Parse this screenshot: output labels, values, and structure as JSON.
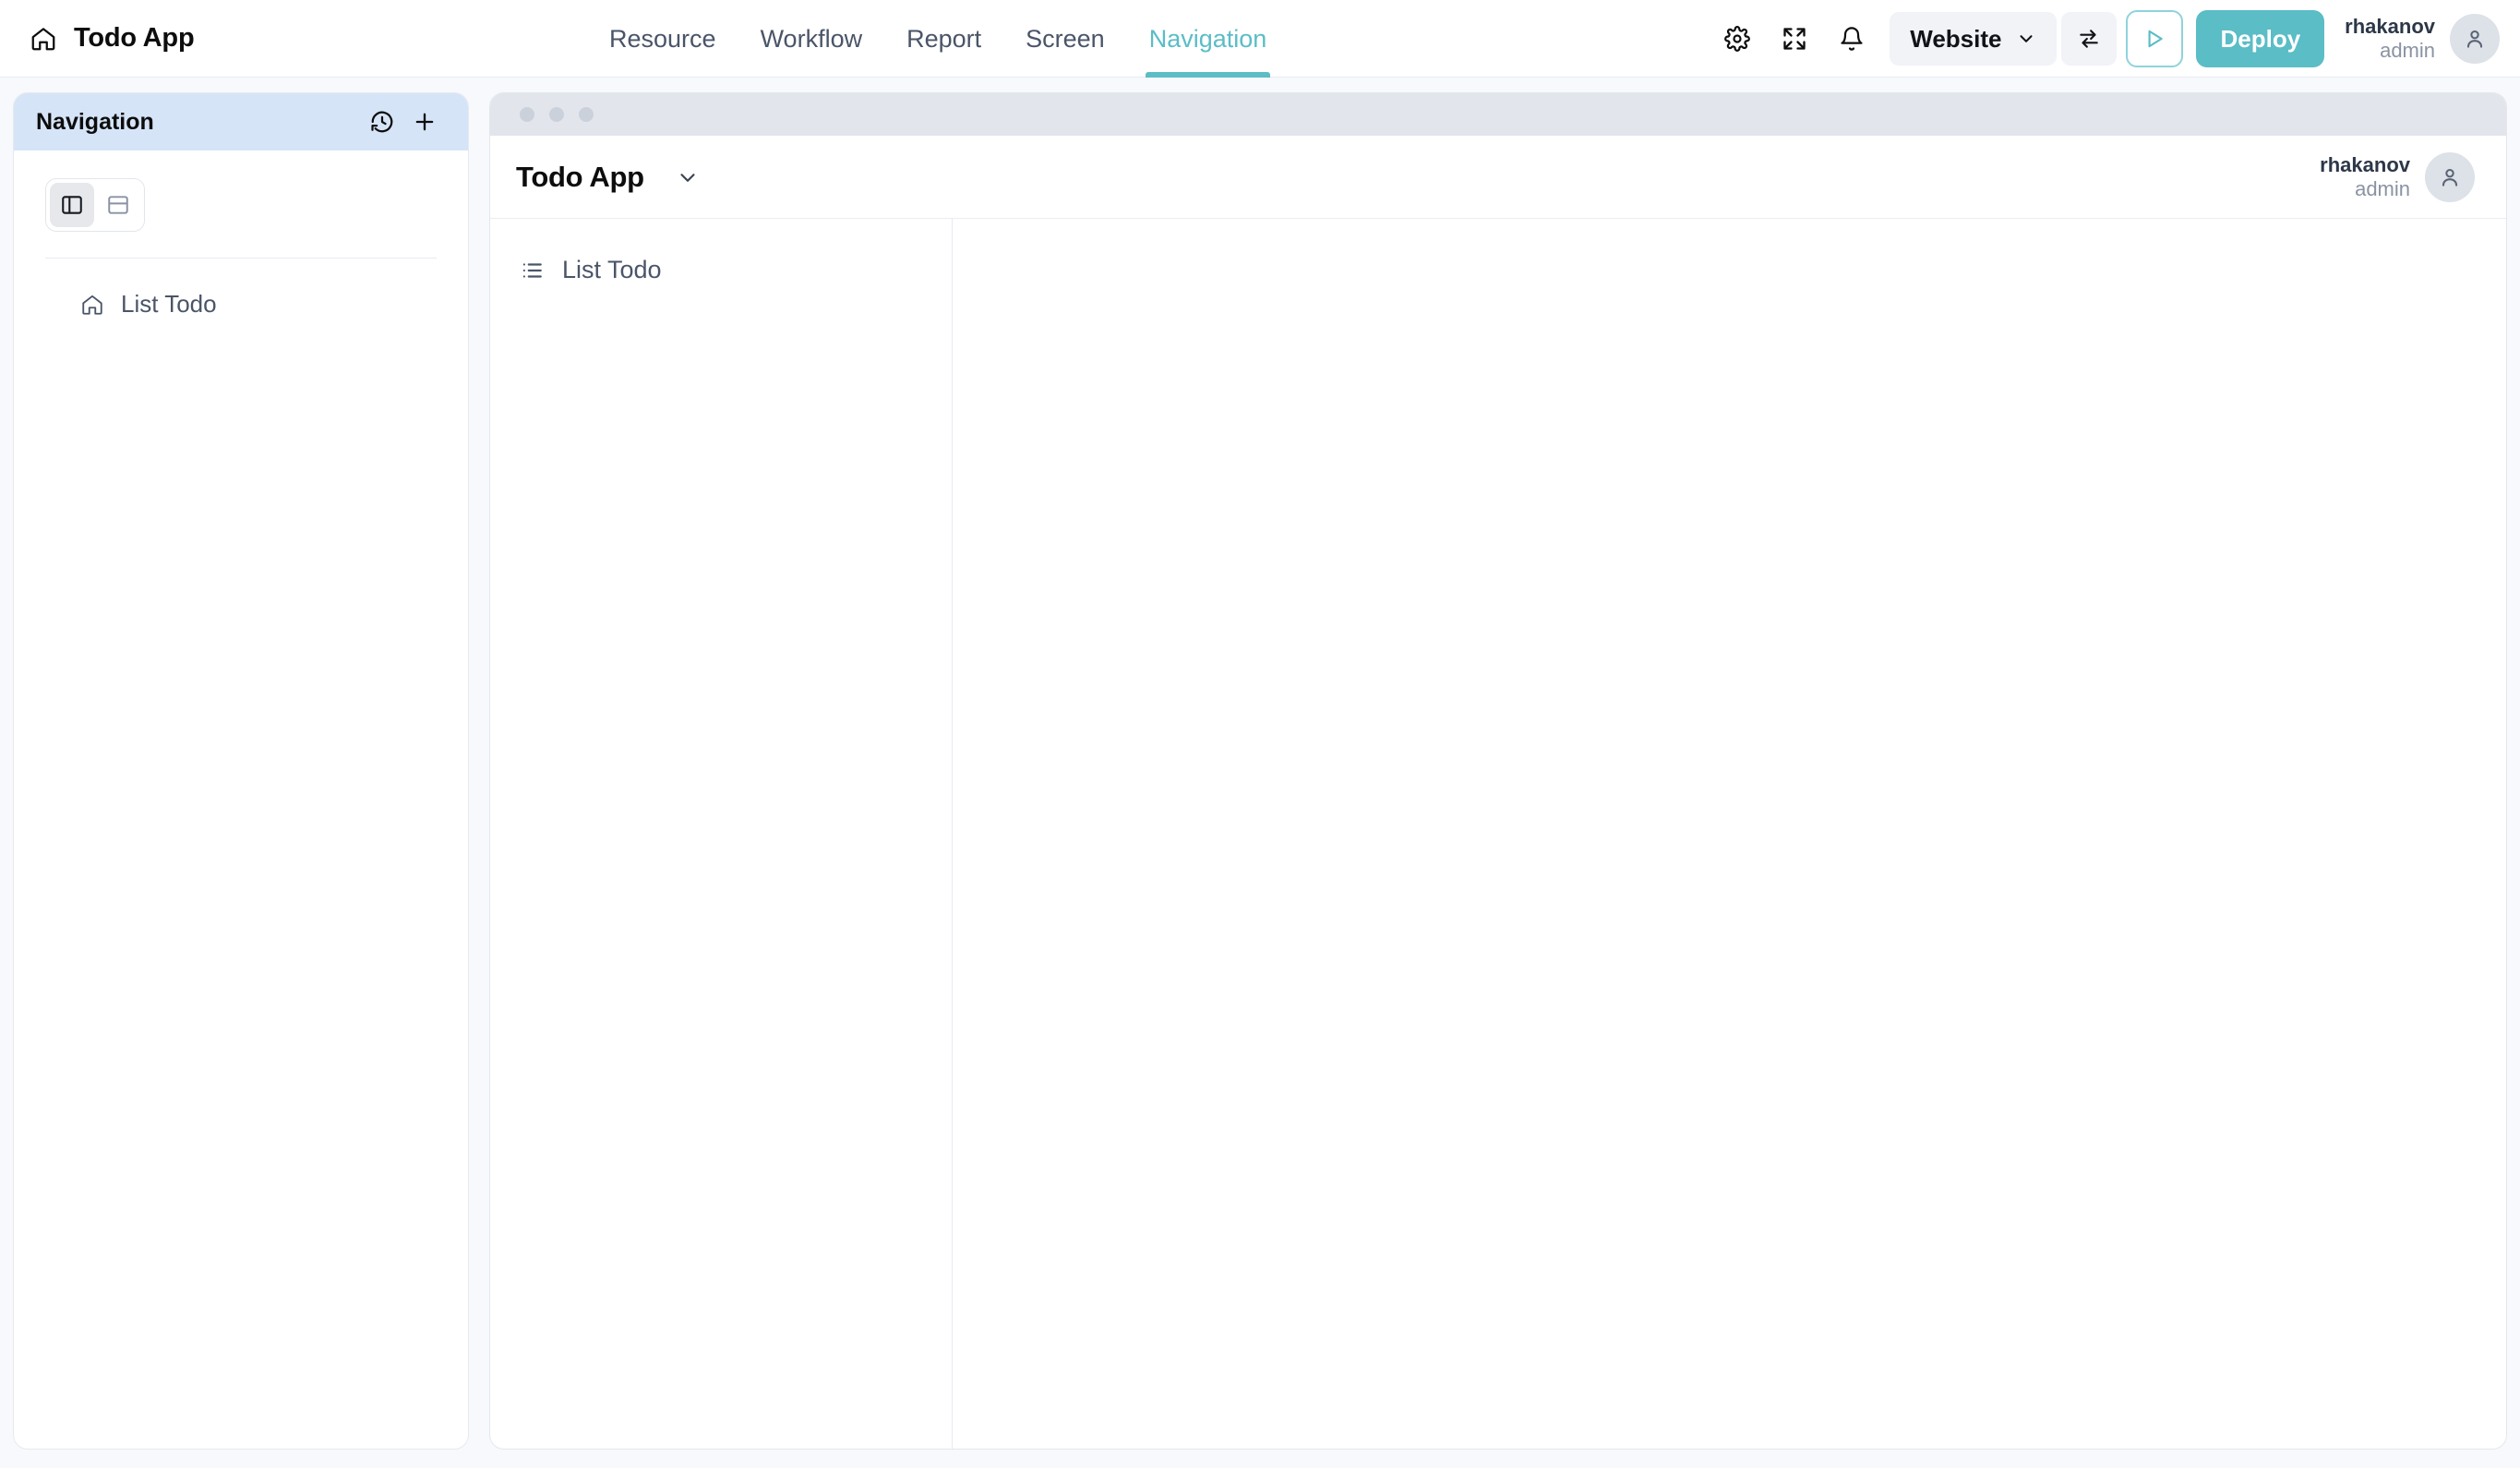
{
  "header": {
    "home_icon": "home-icon",
    "title": "Todo App",
    "tabs": [
      {
        "label": "Resource",
        "active": false
      },
      {
        "label": "Workflow",
        "active": false
      },
      {
        "label": "Report",
        "active": false
      },
      {
        "label": "Screen",
        "active": false
      },
      {
        "label": "Navigation",
        "active": true
      }
    ],
    "actions": {
      "settings_icon": "gear-icon",
      "fullscreen_icon": "expand-icon",
      "notifications_icon": "bell-icon",
      "target_selector": {
        "label": "Website",
        "chevron_icon": "chevron-down-icon"
      },
      "swap_icon": "swap-arrows-icon",
      "preview_icon": "play-icon",
      "deploy_label": "Deploy"
    },
    "user": {
      "name": "rhakanov",
      "role": "admin",
      "avatar_icon": "user-icon"
    }
  },
  "sidebar": {
    "panel_title": "Navigation",
    "history_icon": "history-clock-icon",
    "add_icon": "plus-icon",
    "layout_options": [
      {
        "icon": "sidebar-layout-icon",
        "selected": true
      },
      {
        "icon": "topbar-layout-icon",
        "selected": false
      }
    ],
    "items": [
      {
        "icon": "home-icon",
        "label": "List Todo"
      }
    ]
  },
  "preview": {
    "window_dots": 3,
    "app_title": "Todo App",
    "app_chevron_icon": "chevron-down-icon",
    "user": {
      "name": "rhakanov",
      "role": "admin",
      "avatar_icon": "user-icon"
    },
    "nav_items": [
      {
        "icon": "list-icon",
        "label": "List Todo"
      }
    ]
  },
  "colors": {
    "accent": "#5BBDC6",
    "panel_header_blue": "#D6E4F7",
    "page_background": "#F7F9FC",
    "text_primary": "#0D0D0D",
    "text_secondary": "#4A5568",
    "muted": "#8A93A3"
  }
}
